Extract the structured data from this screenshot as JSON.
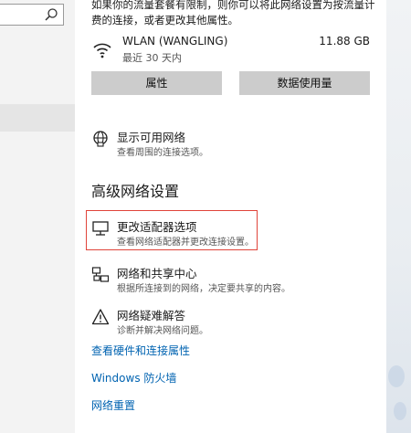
{
  "colors": {
    "accent": "#0063b1",
    "highlight": "#e0443a",
    "button_bg": "#cccccc"
  },
  "left": {
    "search_icon": "search-icon"
  },
  "intro_text": "如果你的流量套餐有限制，则你可以将此网络设置为按流量计费的连接，或者更改其他属性。",
  "network": {
    "name": "WLAN (WANGLING)",
    "sub": "最近 30 天内",
    "size": "11.88 GB",
    "icon": "wifi-signal-icon"
  },
  "buttons": {
    "properties": "属性",
    "data_usage": "数据使用量"
  },
  "show_networks": {
    "title": "显示可用网络",
    "desc": "查看周围的连接选项。",
    "icon": "globe-network-icon"
  },
  "advanced": {
    "heading": "高级网络设置",
    "items": [
      {
        "title": "更改适配器选项",
        "desc": "查看网络适配器并更改连接设置。",
        "icon": "monitor-adapter-icon"
      },
      {
        "title": "网络和共享中心",
        "desc": "根据所连接到的网络，决定要共享的内容。",
        "icon": "sharing-center-icon"
      },
      {
        "title": "网络疑难解答",
        "desc": "诊断并解决网络问题。",
        "icon": "warning-icon"
      }
    ]
  },
  "links": {
    "hardware": "查看硬件和连接属性",
    "firewall": "Windows 防火墙",
    "reset": "网络重置"
  }
}
